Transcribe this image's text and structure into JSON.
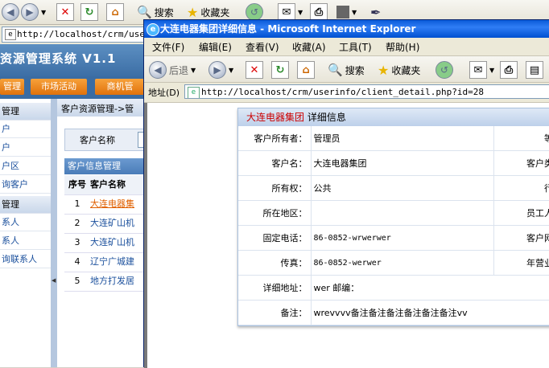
{
  "bg": {
    "toolbar": {
      "search": "搜索",
      "favorites": "收藏夹"
    },
    "address": "http://localhost/crm/userin",
    "app_title": "资源管理系统 V1.1",
    "nav": [
      "管理",
      "市场活动",
      "商机管"
    ],
    "sidebar": [
      "管理",
      "户",
      "户",
      "户区",
      "询客户",
      "管理",
      "系人",
      "系人",
      "询联系人"
    ],
    "breadcrumb": "客户资源管理->管",
    "search_label": "客户名称",
    "table_title": "客户信息管理",
    "table_headers": [
      "序号",
      "客户名称"
    ],
    "rows": [
      {
        "no": "1",
        "name": "大连电器集"
      },
      {
        "no": "2",
        "name": "大连矿山机"
      },
      {
        "no": "3",
        "name": "大连矿山机"
      },
      {
        "no": "4",
        "name": "辽宁广城建"
      },
      {
        "no": "5",
        "name": "地方打发居"
      }
    ]
  },
  "popup": {
    "title": "大连电器集团详细信息 - Microsoft Internet Explorer",
    "menu": [
      "文件(F)",
      "编辑(E)",
      "查看(V)",
      "收藏(A)",
      "工具(T)",
      "帮助(H)"
    ],
    "toolbar": {
      "back": "后退",
      "search": "搜索",
      "favorites": "收藏夹"
    },
    "address_label": "地址(D)",
    "address": "http://localhost/crm/userinfo/client_detail.php?id=28",
    "detail": {
      "company": "大连电器集团",
      "suffix": "详细信息",
      "rows": [
        {
          "k": "客户所有者：",
          "v": "管理员",
          "k2": "等"
        },
        {
          "k": "客户名：",
          "v": "大连电器集团",
          "k2": "客户类"
        },
        {
          "k": "所有权：",
          "v": "公共",
          "k2": "行"
        },
        {
          "k": "所在地区：",
          "v": "",
          "k2": "员工人"
        },
        {
          "k": "固定电话：",
          "v": "86-0852-wrwerwer",
          "k2": "客户网"
        },
        {
          "k": "传真：",
          "v": "86-0852-werwer",
          "k2": "年营业"
        },
        {
          "k": "详细地址：",
          "v": "wer  邮编：",
          "k2": ""
        },
        {
          "k": "备注：",
          "v": "wrevvvv备注备注备注备注备注备注vv",
          "k2": ""
        }
      ]
    }
  }
}
